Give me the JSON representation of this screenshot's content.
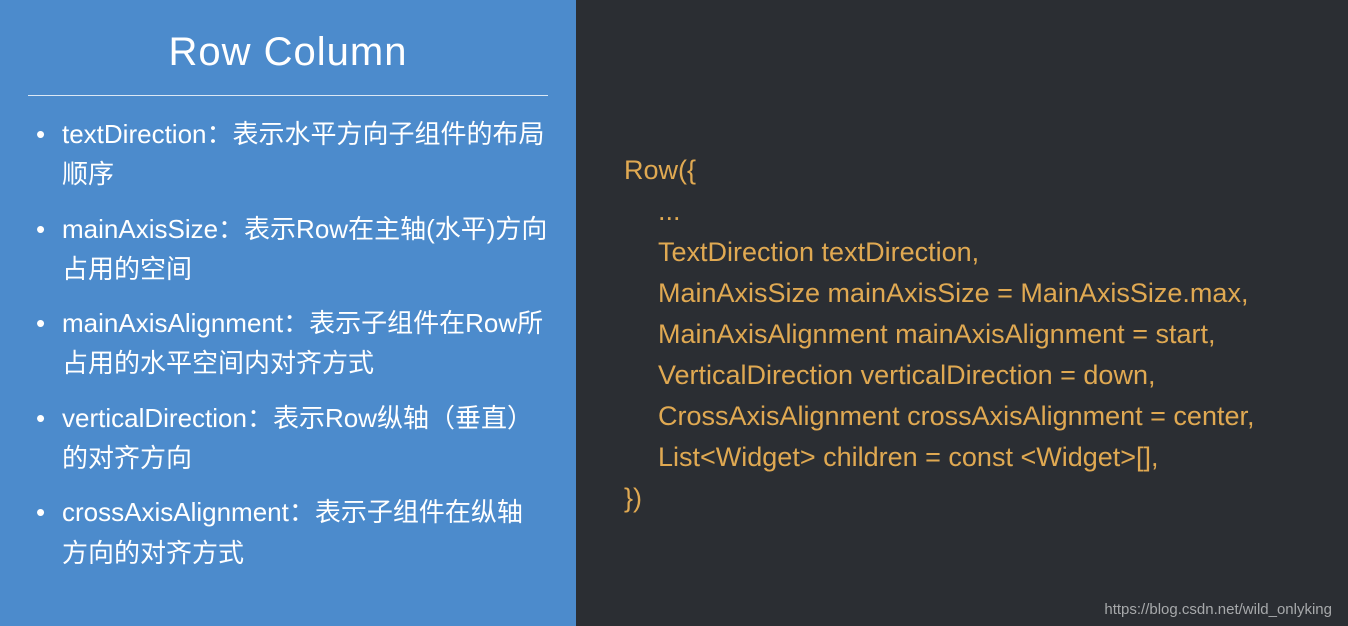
{
  "left": {
    "title": "Row Column",
    "bullets": [
      "textDirection：表示水平方向子组件的布局顺序",
      "mainAxisSize：表示Row在主轴(水平)方向占用的空间",
      "mainAxisAlignment：表示子组件在Row所占用的水平空间内对齐方式",
      "verticalDirection：表示Row纵轴（垂直）的对齐方向",
      "crossAxisAlignment：表示子组件在纵轴方向的对齐方式"
    ]
  },
  "right": {
    "lines": [
      "Row({",
      "...",
      "TextDirection textDirection,",
      "MainAxisSize mainAxisSize = MainAxisSize.max,",
      "MainAxisAlignment mainAxisAlignment = start,",
      "VerticalDirection verticalDirection = down,",
      "CrossAxisAlignment crossAxisAlignment = center,",
      "List<Widget> children = const <Widget>[],",
      "})"
    ]
  },
  "watermark": "https://blog.csdn.net/wild_onlyking"
}
